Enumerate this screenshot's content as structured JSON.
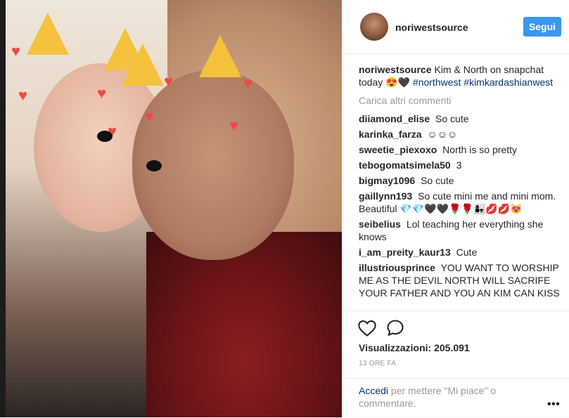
{
  "header": {
    "username": "noriwestsource",
    "follow_label": "Segui"
  },
  "caption": {
    "username": "noriwestsource",
    "text": "Kim & North on snapchat today 😍🖤",
    "tag1": "#northwest",
    "tag2": "#kimkardashianwest"
  },
  "load_more_label": "Carica altri commenti",
  "comments": [
    {
      "user": "diiamond_elise",
      "text": "So cute"
    },
    {
      "user": "karinka_farza",
      "text": "☺☺☺"
    },
    {
      "user": "sweetie_piexoxo",
      "text": "North is so pretty"
    },
    {
      "user": "tebogomatsimela50",
      "text": "3"
    },
    {
      "user": "bigmay1096",
      "text": "So cute"
    },
    {
      "user": "gaillynn193",
      "text": "So cute mini me and mini mom. Beautiful 💎💎🖤🖤🌹🌹👩‍👧💋💋😻"
    },
    {
      "user": "seibelius",
      "text": "Lol teaching her everything she knows"
    },
    {
      "user": "i_am_preity_kaur13",
      "text": "Cute"
    },
    {
      "user": "illustriousprince",
      "text": "YOU WANT TO WORSHIP ME AS THE DEVIL NORTH WILL SACRIFE YOUR FATHER AND YOU AN KIM CAN KISS"
    }
  ],
  "views_label": "Visualizzazioni: 205.091",
  "timestamp": "13 ORE FA",
  "login": {
    "link": "Accedi",
    "text": " per mettere \"Mi piace\" o commentare."
  },
  "more_label": "•••",
  "icons": {
    "like": "heart-outline-icon",
    "comment": "speech-bubble-icon",
    "more": "more-options-icon"
  },
  "colors": {
    "accent": "#3897f0",
    "link": "#003569",
    "muted": "#999999"
  }
}
